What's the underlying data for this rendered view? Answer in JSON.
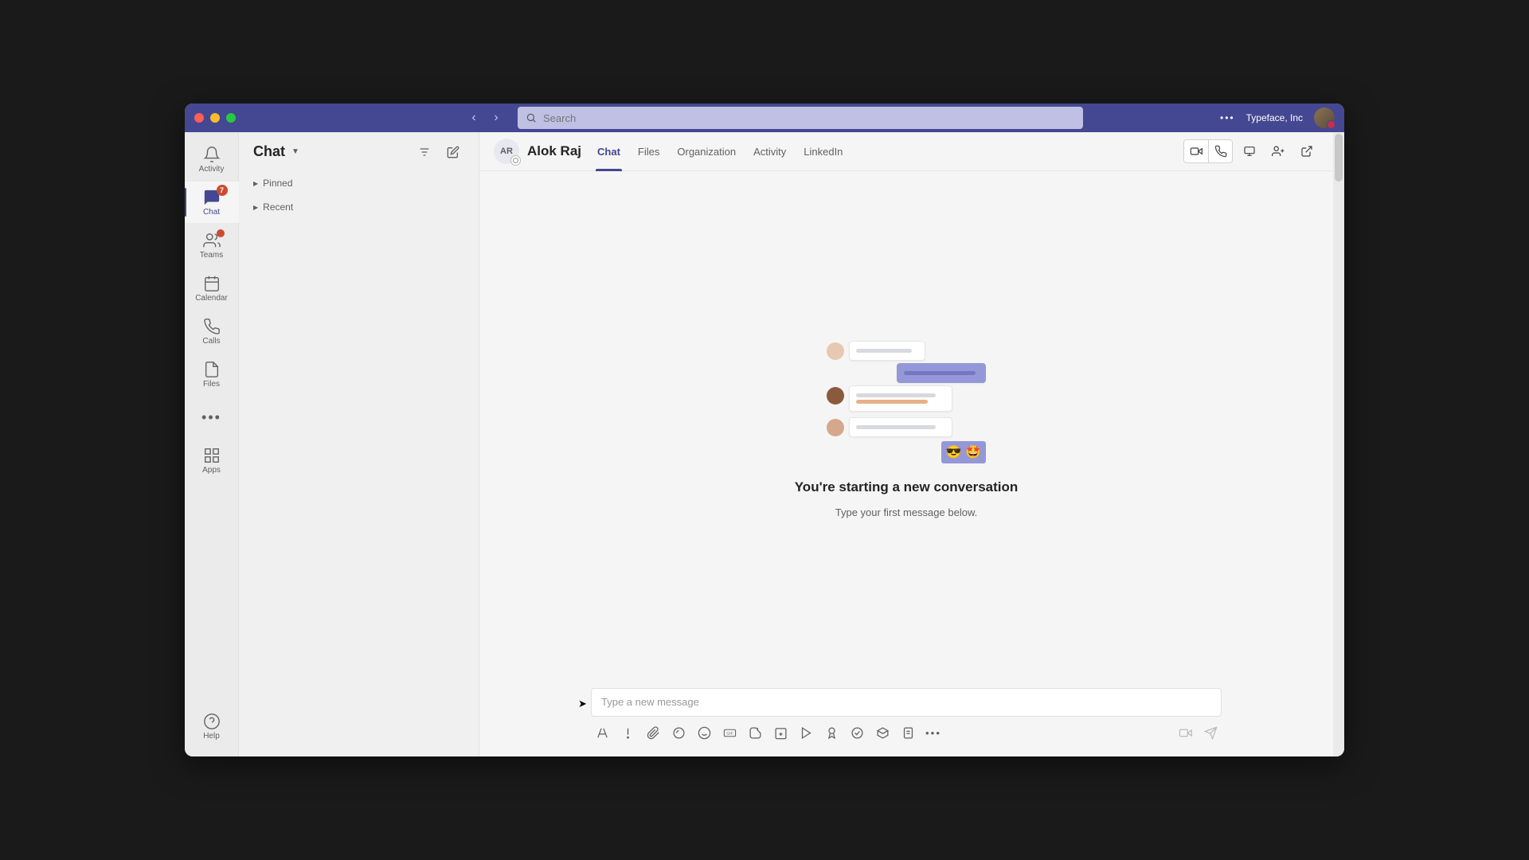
{
  "titlebar": {
    "search_placeholder": "Search",
    "org_name": "Typeface, Inc"
  },
  "rail": {
    "items": [
      {
        "key": "activity",
        "label": "Activity"
      },
      {
        "key": "chat",
        "label": "Chat",
        "badge": "7",
        "active": true
      },
      {
        "key": "teams",
        "label": "Teams",
        "badge": ""
      },
      {
        "key": "calendar",
        "label": "Calendar"
      },
      {
        "key": "calls",
        "label": "Calls"
      },
      {
        "key": "files",
        "label": "Files"
      }
    ],
    "apps_label": "Apps",
    "help_label": "Help"
  },
  "listpane": {
    "title": "Chat",
    "sections": [
      {
        "label": "Pinned"
      },
      {
        "label": "Recent"
      }
    ]
  },
  "chat": {
    "person_initials": "AR",
    "person_name": "Alok Raj",
    "tabs": [
      {
        "label": "Chat",
        "active": true
      },
      {
        "label": "Files"
      },
      {
        "label": "Organization"
      },
      {
        "label": "Activity"
      },
      {
        "label": "LinkedIn"
      }
    ],
    "empty_title": "You're starting a new conversation",
    "empty_sub": "Type your first message below.",
    "emoji": "😎 🤩"
  },
  "composer": {
    "placeholder": "Type a new message"
  }
}
